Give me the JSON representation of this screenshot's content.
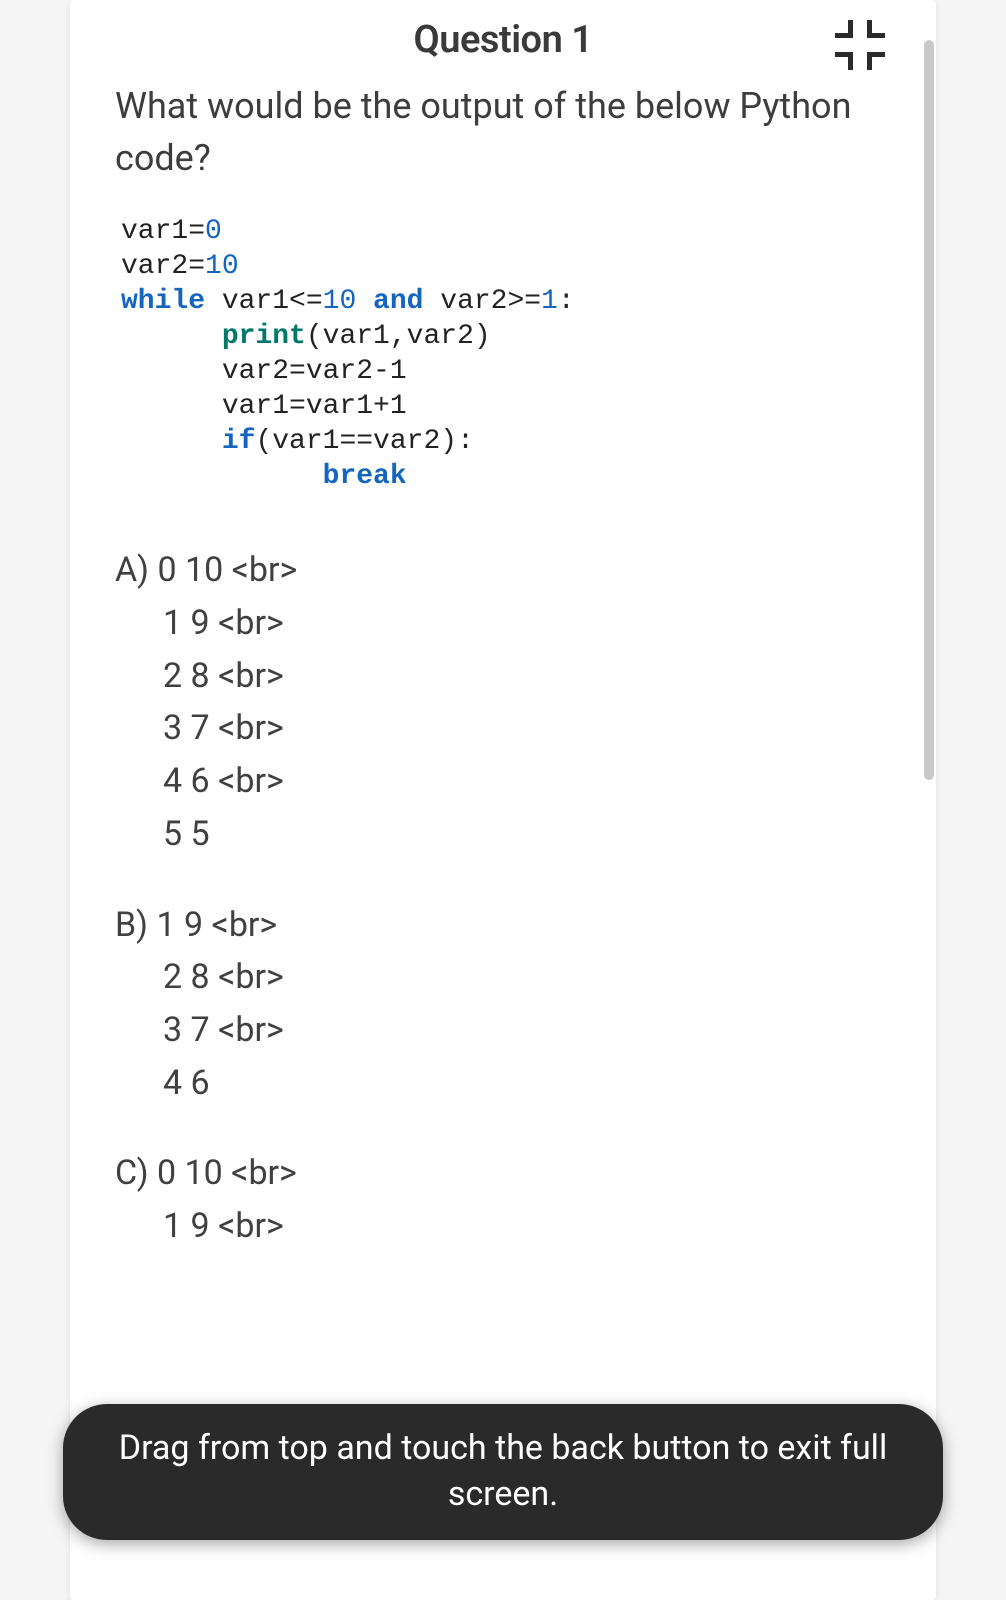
{
  "header": {
    "title": "Question 1"
  },
  "question": {
    "prompt": "What would be the output of the below Python code?"
  },
  "code": {
    "l1a": "var1=",
    "l1b": "0",
    "l2a": "var2=",
    "l2b": "10",
    "l3a": "while",
    "l3b": " var1<=",
    "l3c": "10",
    "l3d": " and",
    "l3e": " var2>=",
    "l3f": "1",
    "l3g": ":",
    "l4a": "      ",
    "l4b": "print",
    "l4c": "(var1,var2)",
    "l5": "      var2=var2-1",
    "l6": "      var1=var1+1",
    "l7a": "      ",
    "l7b": "if",
    "l7c": "(var1==var2):",
    "l8a": "            ",
    "l8b": "break"
  },
  "answers": {
    "A": {
      "label": "A) 0 10 <br>",
      "lines": [
        "1 9 <br>",
        "2 8 <br>",
        "3 7 <br>",
        "4 6 <br>",
        "5 5"
      ]
    },
    "B": {
      "label": "B) 1 9 <br>",
      "lines": [
        "2 8 <br>",
        "3 7 <br>",
        "4 6"
      ]
    },
    "C": {
      "label": "C) 0 10 <br>",
      "lines": [
        "1 9 <br>"
      ]
    }
  },
  "toast": {
    "text": "Drag from top and touch the back button to exit full screen."
  }
}
